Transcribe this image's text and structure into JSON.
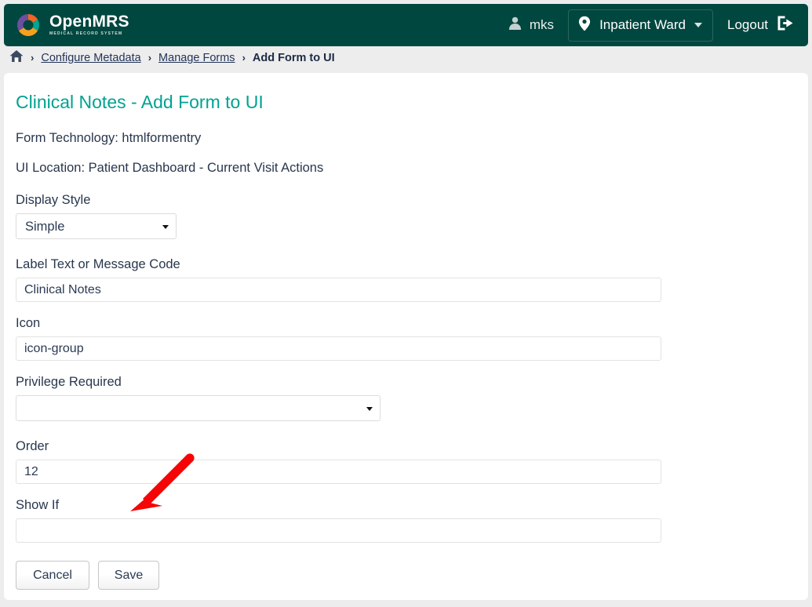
{
  "header": {
    "brand_name": "OpenMRS",
    "brand_tagline": "MEDICAL RECORD SYSTEM",
    "user_icon": "user-icon",
    "username": "mks",
    "location_icon": "map-pin-icon",
    "location": "Inpatient Ward",
    "location_caret": "chevron-down-icon",
    "logout_label": "Logout",
    "logout_icon": "sign-out-icon",
    "bg_color": "#00473f"
  },
  "breadcrumb": {
    "home_icon": "home-icon",
    "separator": "›",
    "items": [
      {
        "label": "Configure Metadata",
        "current": false
      },
      {
        "label": "Manage Forms",
        "current": false
      },
      {
        "label": "Add Form to UI",
        "current": true
      }
    ]
  },
  "main": {
    "title": "Clinical Notes - Add Form to UI",
    "title_color": "#00a291",
    "meta": [
      "Form Technology: htmlformentry",
      "UI Location: Patient Dashboard - Current Visit Actions"
    ],
    "fields": {
      "display_style": {
        "label": "Display Style",
        "value": "Simple",
        "options": [
          "Simple"
        ]
      },
      "label_text": {
        "label": "Label Text or Message Code",
        "value": "Clinical Notes",
        "placeholder": ""
      },
      "icon": {
        "label": "Icon",
        "value": "icon-group",
        "placeholder": ""
      },
      "privilege_required": {
        "label": "Privilege Required",
        "value": "",
        "options": [
          ""
        ]
      },
      "order": {
        "label": "Order",
        "value": "12",
        "placeholder": ""
      },
      "show_if": {
        "label": "Show If",
        "value": "",
        "placeholder": ""
      }
    },
    "buttons": {
      "cancel_label": "Cancel",
      "save_label": "Save"
    }
  },
  "annotation": {
    "arrow_color": "#f50505",
    "arrow_name": "red-pointer-arrow"
  }
}
